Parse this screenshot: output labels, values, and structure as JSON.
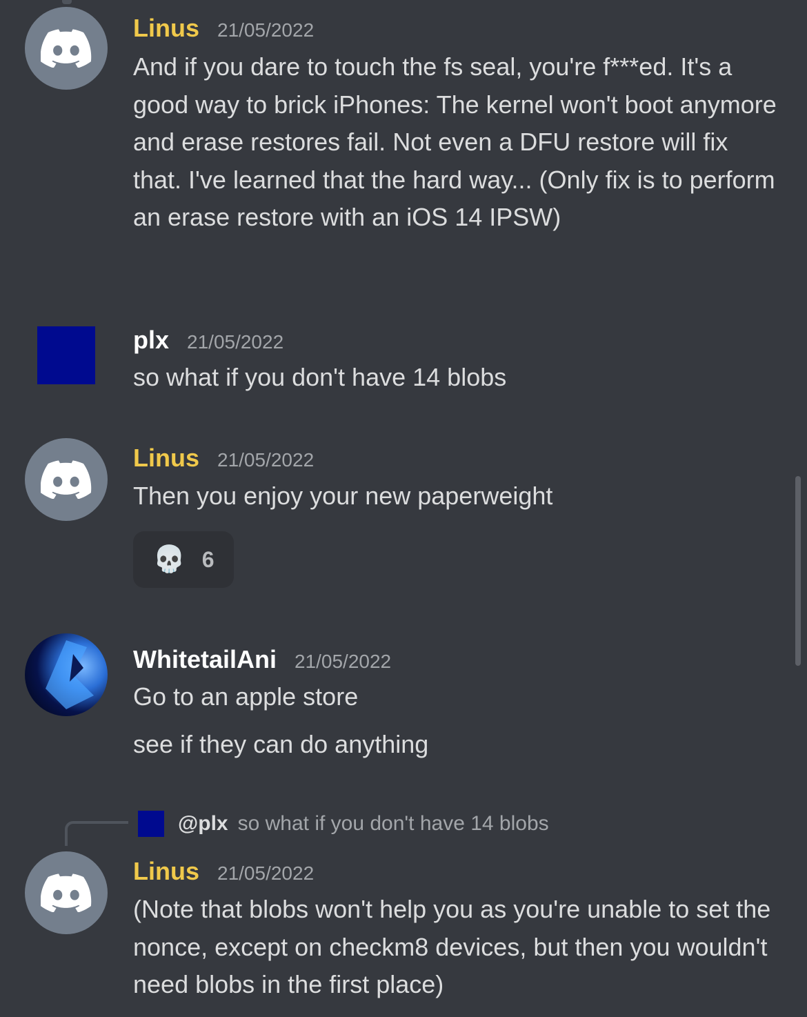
{
  "messages": [
    {
      "author": "Linus",
      "timestamp": "21/05/2022",
      "avatar_icon": "discord-logo-icon",
      "lines": [
        "And if you dare to touch the fs seal, you're f***ed. It's a good way to brick iPhones: The kernel won't boot anymore and erase restores fail. Not even a DFU restore will fix that. I've learned that the hard way... (Only fix is to perform an erase restore with an iOS 14 IPSW)"
      ]
    },
    {
      "author": "plx",
      "timestamp": "21/05/2022",
      "avatar_color": "#000a8f",
      "lines": [
        "so what if you don't have 14 blobs"
      ]
    },
    {
      "author": "Linus",
      "timestamp": "21/05/2022",
      "avatar_icon": "discord-logo-icon",
      "lines": [
        "Then you enjoy your new paperweight"
      ],
      "reaction": {
        "emoji": "💀",
        "count": "6"
      }
    },
    {
      "author": "WhitetailAni",
      "timestamp": "21/05/2022",
      "lines": [
        "Go to an apple store",
        "see if they can do anything"
      ]
    },
    {
      "author": "Linus",
      "timestamp": "21/05/2022",
      "avatar_icon": "discord-logo-icon",
      "reply": {
        "author": "@plx",
        "text": "so what if you don't have 14 blobs"
      },
      "lines": [
        "(Note that blobs won't help you as you're unable to set the nonce, except on checkm8 devices, but then you wouldn't need blobs in the first place)"
      ]
    }
  ],
  "colors": {
    "background": "#36393f",
    "linus_name": "#f0c94b",
    "text": "#dcddde",
    "timestamp": "#a3a6aa"
  }
}
